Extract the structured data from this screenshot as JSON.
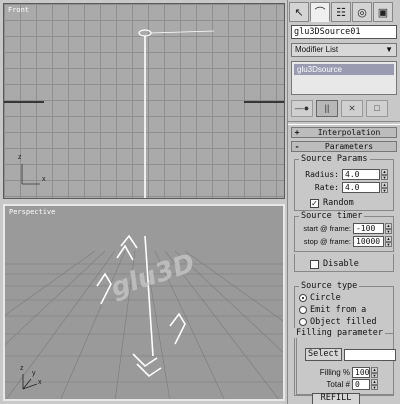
{
  "viewports": {
    "front": {
      "label": "Front",
      "axis_x": "x",
      "axis_y": "z"
    },
    "perspective": {
      "label": "Perspective",
      "axis_x": "x",
      "axis_y": "y",
      "axis_z": "z",
      "logo_text": "glu3D"
    }
  },
  "panel": {
    "tabs": [
      {
        "icon": "create-icon",
        "glyph": "↖"
      },
      {
        "icon": "modify-icon",
        "glyph": "⌒"
      },
      {
        "icon": "hierarchy-icon",
        "glyph": "☷"
      },
      {
        "icon": "motion-icon",
        "glyph": "◎"
      },
      {
        "icon": "display-icon",
        "glyph": "▣"
      }
    ],
    "object_name": "glu3DSource01",
    "modifier_list": {
      "label": "Modifier List",
      "arrow": "▼"
    },
    "stack_items": [
      "glu3Dsource"
    ],
    "stack_tools": [
      {
        "icon": "pin-stack-icon",
        "glyph": "—●"
      },
      {
        "icon": "show-end-result-icon",
        "glyph": "||"
      },
      {
        "icon": "make-unique-icon",
        "glyph": "⨯"
      },
      {
        "icon": "remove-modifier-icon",
        "glyph": "⬚"
      },
      {
        "icon": "configure-sets-icon",
        "glyph": "□"
      }
    ],
    "rollouts": {
      "interpolation": {
        "sign": "+",
        "title": "Interpolation"
      },
      "parameters": {
        "sign": "-",
        "title": "Parameters"
      }
    },
    "source_params": {
      "title": "Source Params",
      "radius": {
        "label": "Radius:",
        "value": "4.0"
      },
      "rate": {
        "label": "Rate:",
        "value": "4.0"
      },
      "random": {
        "label": "Random",
        "checked": true,
        "mark": "✓"
      }
    },
    "source_timer": {
      "title": "Source timer",
      "start": {
        "label": "start @ frame:",
        "value": "-100"
      },
      "stop": {
        "label": "stop @ frame:",
        "value": "10000"
      }
    },
    "disable": {
      "label": "Disable",
      "checked": false
    },
    "source_type": {
      "title": "Source type",
      "options": [
        {
          "label": "Circle",
          "selected": true
        },
        {
          "label": "Emit from a",
          "selected": false
        },
        {
          "label": "Object filled",
          "selected": false
        }
      ]
    },
    "filling": {
      "title": "Filling parameter",
      "select_label": "Select",
      "select_value": "",
      "filling_pct": {
        "label": "Filling %",
        "value": "100"
      },
      "total": {
        "label": "Total #",
        "value": "0"
      },
      "refill_label": "REFILL"
    }
  }
}
